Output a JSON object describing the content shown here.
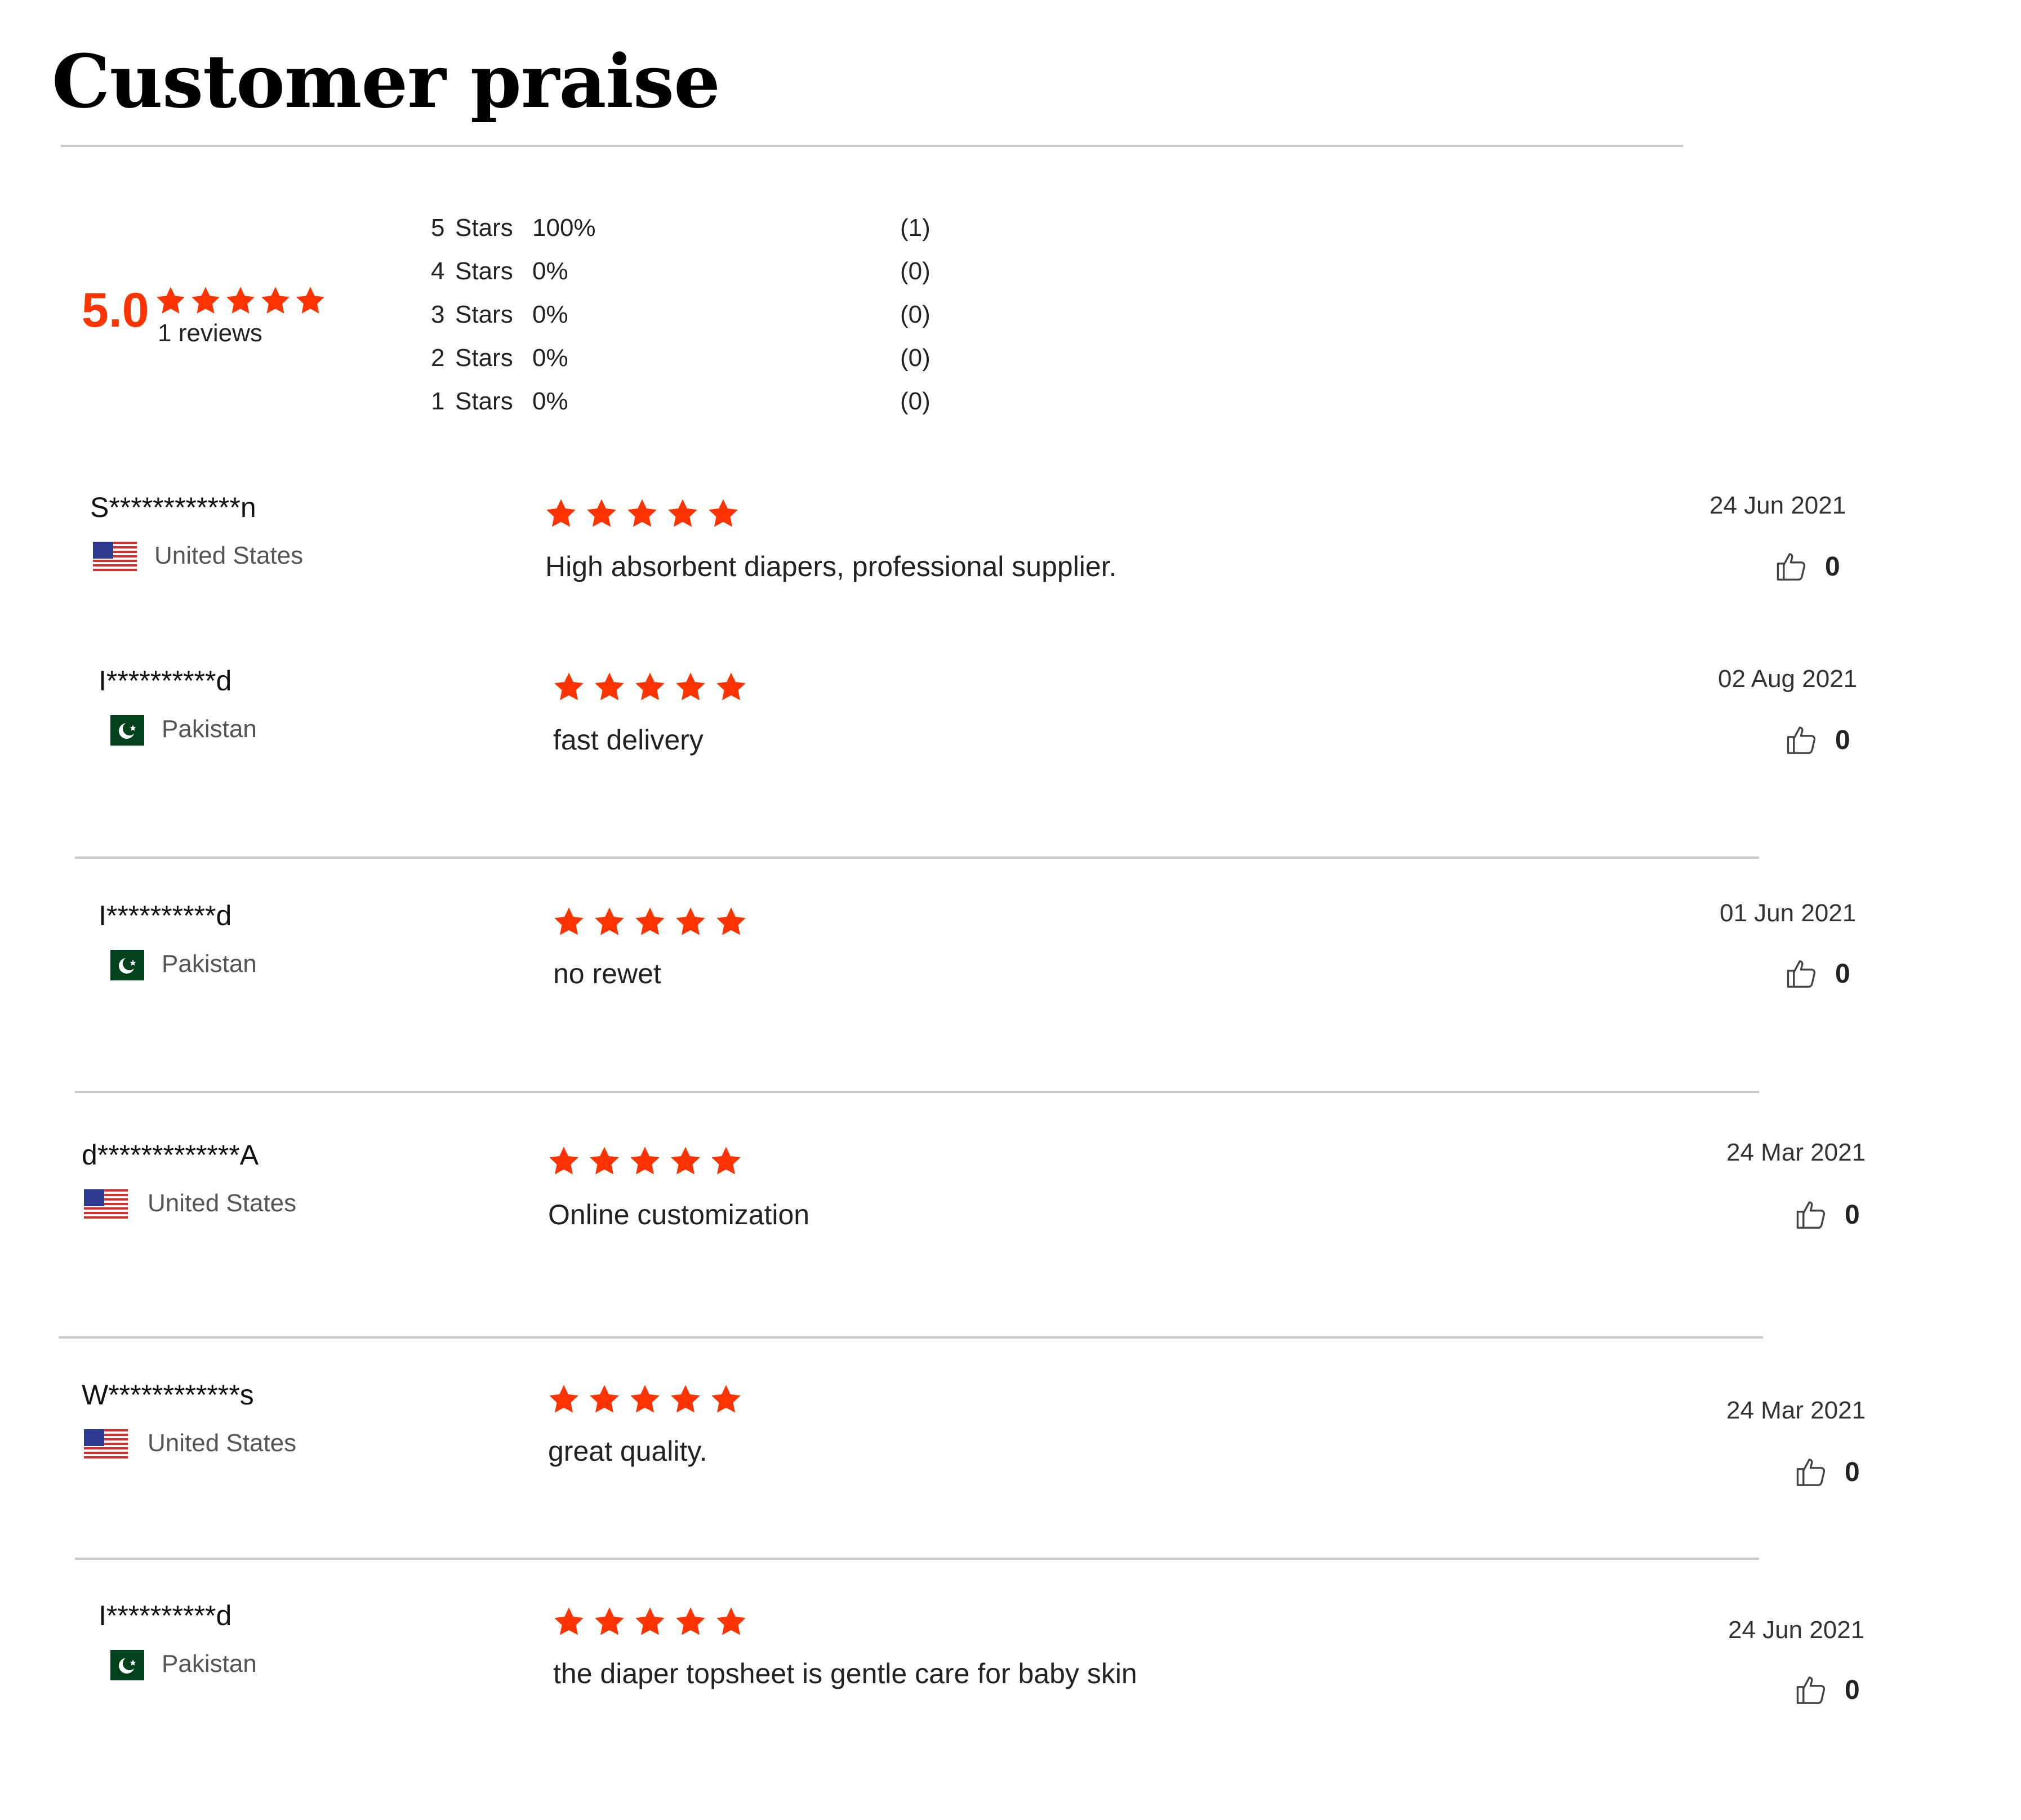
{
  "page": {
    "title": "Customer praise"
  },
  "summary": {
    "average": "5.0",
    "average_stars": 5,
    "reviews_label": "1 reviews",
    "distribution": [
      {
        "num": "5",
        "stars": "Stars",
        "pct": "100%",
        "count": "(1)"
      },
      {
        "num": "4",
        "stars": "Stars",
        "pct": "0%",
        "count": "(0)"
      },
      {
        "num": "3",
        "stars": "Stars",
        "pct": "0%",
        "count": "(0)"
      },
      {
        "num": "2",
        "stars": "Stars",
        "pct": "0%",
        "count": "(0)"
      },
      {
        "num": "1",
        "stars": "Stars",
        "pct": "0%",
        "count": "(0)"
      }
    ]
  },
  "reviews": [
    {
      "name": "S************n",
      "country": "United States",
      "flag": "us-flag-icon",
      "rating": 5,
      "text": "High absorbent diapers, professional supplier.",
      "date": "24 Jun 2021",
      "likes": "0"
    },
    {
      "name": "I**********d",
      "country": "Pakistan",
      "flag": "pk-flag-icon",
      "rating": 5,
      "text": "fast delivery",
      "date": "02 Aug 2021",
      "likes": "0"
    },
    {
      "name": "I**********d",
      "country": "Pakistan",
      "flag": "pk-flag-icon",
      "rating": 5,
      "text": "no rewet",
      "date": "01 Jun 2021",
      "likes": "0"
    },
    {
      "name": "d*************A",
      "country": "United States",
      "flag": "us-flag-icon",
      "rating": 5,
      "text": "Online customization",
      "date": "24 Mar 2021",
      "likes": "0"
    },
    {
      "name": "W************s",
      "country": "United States",
      "flag": "us-flag-icon",
      "rating": 5,
      "text": "great quality.",
      "date": "24 Mar 2021",
      "likes": "0"
    },
    {
      "name": "I**********d",
      "country": "Pakistan",
      "flag": "pk-flag-icon",
      "rating": 5,
      "text": "the diaper topsheet is gentle care for baby skin",
      "date": "24 Jun 2021",
      "likes": "0"
    }
  ],
  "colors": {
    "accent": "#ff3300",
    "divider": "#c9c9c9",
    "pk_green": "#01411c",
    "us_red": "#d32f2f",
    "us_blue": "#2b3a8f"
  },
  "icons": {
    "star": "star-icon",
    "like": "thumbs-up-icon"
  }
}
